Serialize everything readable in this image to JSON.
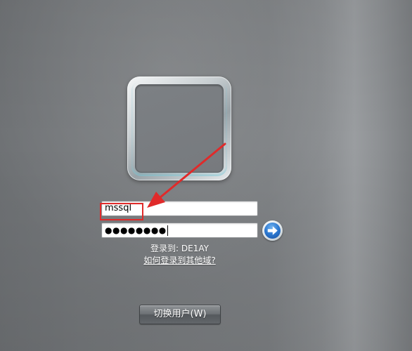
{
  "login": {
    "username_value": "mssql",
    "password_masked": "●●●●●●●●",
    "logon_to_label": "登录到:",
    "domain_name": "DE1AY",
    "other_domain_link": "如何登录到其他域?",
    "switch_user_label": "切换用户(W)"
  },
  "icons": {
    "submit": "right-arrow-icon",
    "user_tile": "user-picture-frame"
  },
  "colors": {
    "annotation": "#e02a2a",
    "arrow_button": "#2b77cf"
  }
}
